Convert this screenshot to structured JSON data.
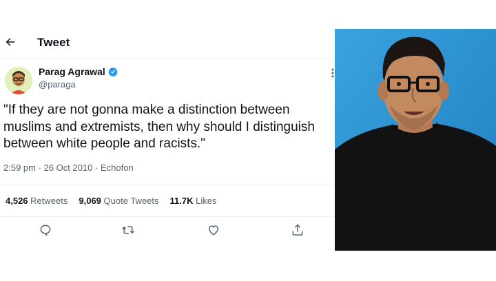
{
  "header": {
    "title": "Tweet"
  },
  "author": {
    "name": "Parag Agrawal",
    "handle": "@paraga"
  },
  "tweet": {
    "text": "\"If they are not gonna make a distinction between muslims and extremists, then why should I distinguish between white people and racists.\"",
    "time": "2:59 pm",
    "date": "26 Oct 2010",
    "source": "Echofon"
  },
  "stats": {
    "retweets_count": "4,526",
    "retweets_label": "Retweets",
    "quotes_count": "9,069",
    "quotes_label": "Quote Tweets",
    "likes_count": "11.7K",
    "likes_label": "Likes"
  },
  "colors": {
    "verified": "#1d9bf0",
    "muted": "#536471",
    "photo_bg": "#2f98d6"
  },
  "icons": [
    "back-arrow-icon",
    "verified-badge-icon",
    "more-icon",
    "reply-icon",
    "retweet-icon",
    "like-icon",
    "share-icon"
  ]
}
